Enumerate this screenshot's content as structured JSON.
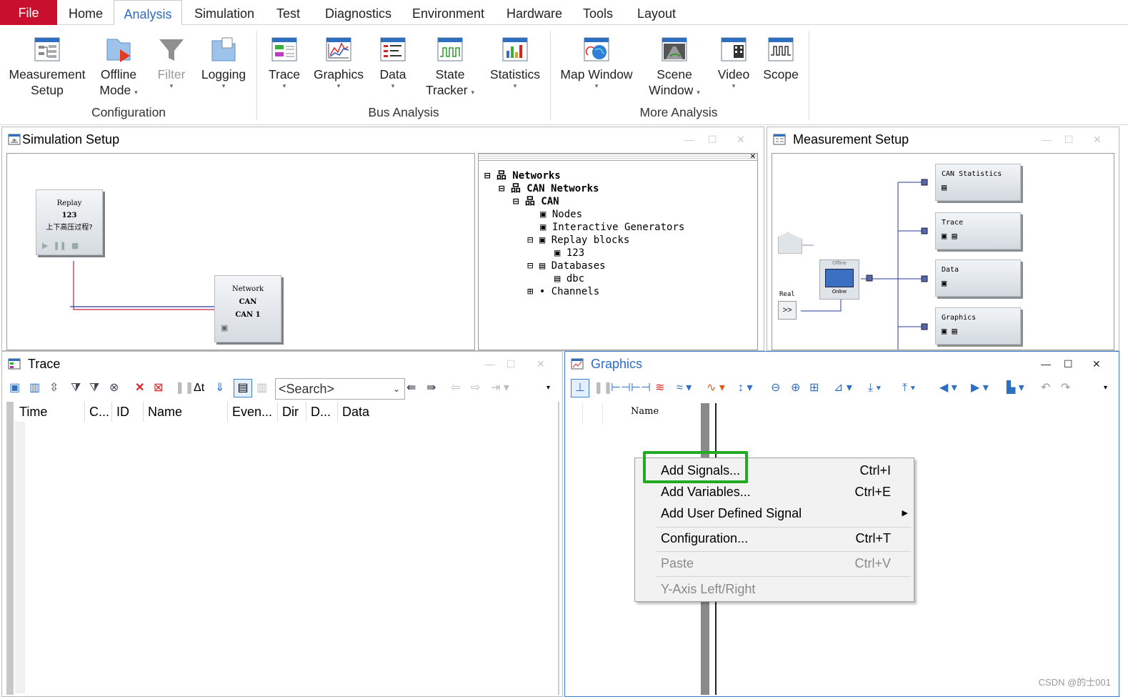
{
  "menu": {
    "tabs": [
      "File",
      "Home",
      "Analysis",
      "Simulation",
      "Test",
      "Diagnostics",
      "Environment",
      "Hardware",
      "Tools",
      "Layout"
    ],
    "active": "Analysis"
  },
  "ribbon": {
    "buttons": [
      {
        "l1": "Measurement",
        "l2": "Setup",
        "icon": "measurement-setup-icon"
      },
      {
        "l1": "Offline",
        "l2": "Mode",
        "icon": "offline-mode-icon"
      },
      {
        "l1": "Filter",
        "l2": "",
        "icon": "filter-icon"
      },
      {
        "l1": "Logging",
        "l2": "",
        "icon": "logging-icon"
      },
      {
        "l1": "Trace",
        "l2": "",
        "icon": "trace-icon"
      },
      {
        "l1": "Graphics",
        "l2": "",
        "icon": "graphics-icon"
      },
      {
        "l1": "Data",
        "l2": "",
        "icon": "data-icon"
      },
      {
        "l1": "State",
        "l2": "Tracker",
        "icon": "state-tracker-icon"
      },
      {
        "l1": "Statistics",
        "l2": "",
        "icon": "statistics-icon"
      },
      {
        "l1": "Map Window",
        "l2": "",
        "icon": "map-window-icon"
      },
      {
        "l1": "Scene",
        "l2": "Window",
        "icon": "scene-window-icon"
      },
      {
        "l1": "Video",
        "l2": "",
        "icon": "video-icon"
      },
      {
        "l1": "Scope",
        "l2": "",
        "icon": "scope-icon"
      }
    ],
    "groups": [
      "Configuration",
      "Bus Analysis",
      "More Analysis"
    ]
  },
  "simulation": {
    "title": "Simulation Setup",
    "replay_block": {
      "l1": "Replay",
      "l2": "123",
      "l3": "上下高压过程?"
    },
    "network_block": {
      "l1": "Network",
      "l2": "CAN",
      "l3": "CAN  1"
    },
    "tree": [
      "Networks",
      "CAN Networks",
      "CAN",
      "Nodes",
      "Interactive Generators",
      "Replay blocks",
      "123",
      "Databases",
      "dbc",
      "Channels"
    ]
  },
  "measurement": {
    "title": "Measurement Setup",
    "boxes": [
      "CAN Statistics",
      "Trace",
      "Data",
      "Graphics"
    ],
    "offline": "Offline",
    "online": "Online",
    "real": "Real",
    "real_btn": ">>"
  },
  "trace": {
    "title": "Trace",
    "search_placeholder": "<Search>",
    "columns": [
      "Time",
      "C...",
      "ID",
      "Name",
      "Even...",
      "Dir",
      "D...",
      "Data"
    ]
  },
  "graphics": {
    "title": "Graphics",
    "name_col": "Name"
  },
  "context_menu": {
    "items": [
      {
        "label": "Add Signals...",
        "shortcut": "Ctrl+I",
        "enabled": true,
        "highlighted": true
      },
      {
        "label": "Add Variables...",
        "shortcut": "Ctrl+E",
        "enabled": true
      },
      {
        "label": "Add User Defined Signal",
        "shortcut": "",
        "enabled": true,
        "submenu": true
      },
      {
        "label": "Configuration...",
        "shortcut": "Ctrl+T",
        "enabled": true
      },
      {
        "label": "Paste",
        "shortcut": "Ctrl+V",
        "enabled": false
      },
      {
        "label": "Y-Axis Left/Right",
        "shortcut": "",
        "enabled": false
      }
    ]
  },
  "watermark": "CSDN @的士001",
  "colors": {
    "file_tab": "#c8102e",
    "active_tab": "#2b6cc4",
    "highlight_box": "#22aa22"
  }
}
